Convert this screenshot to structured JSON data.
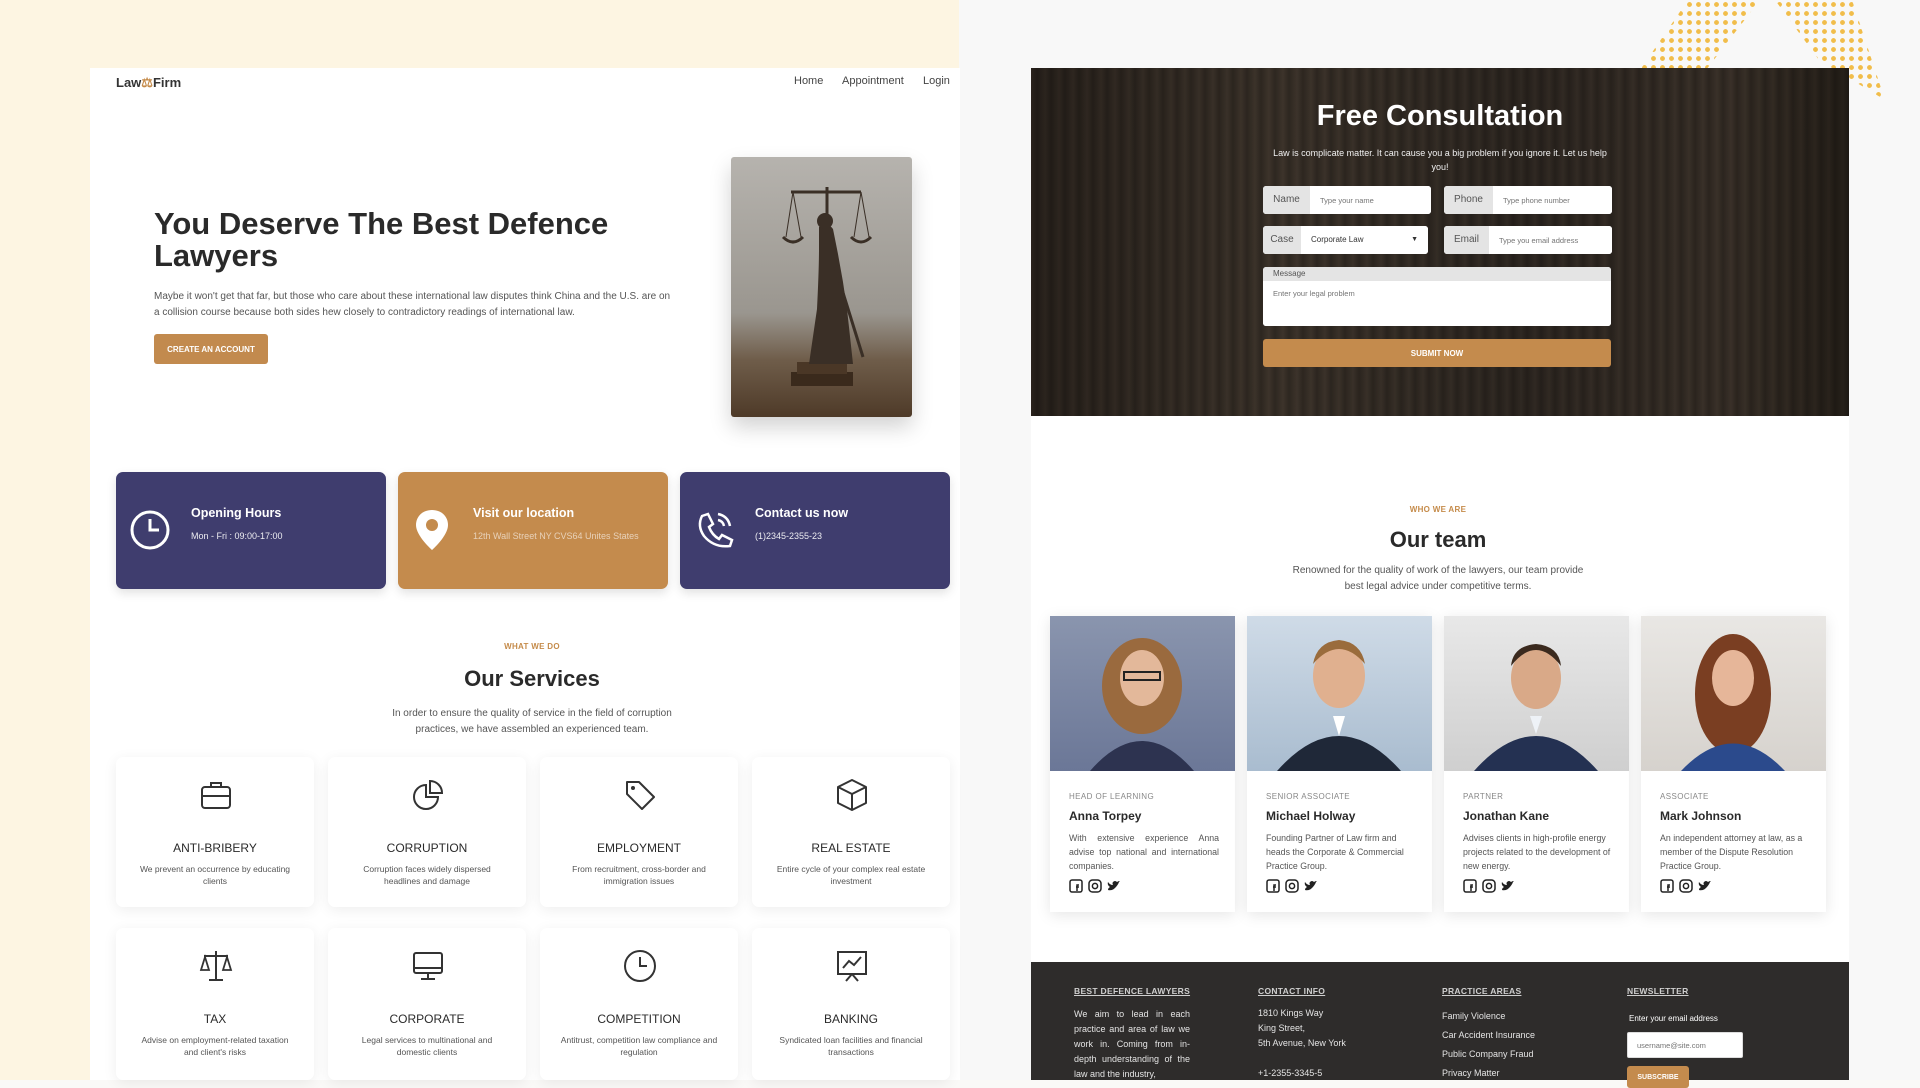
{
  "site": {
    "logo_left": "Law",
    "logo_mark": "⚖",
    "logo_right": "Firm",
    "nav": [
      "Home",
      "Appointment",
      "Login"
    ]
  },
  "hero": {
    "title": "You Deserve The Best Defence Lawyers",
    "text": "Maybe it won't get that far, but those who care about these international law disputes think China and the U.S. are on a collision course because both sides hew closely to contradictory readings of international law.",
    "cta": "CREATE AN ACCOUNT"
  },
  "info_cards": [
    {
      "title": "Opening Hours",
      "sub": "Mon - Fri : 09:00-17:00",
      "icon": "clock-icon"
    },
    {
      "title": "Visit our location",
      "sub": "12th Wall Street NY CVS64 Unites States",
      "icon": "location-pin-icon"
    },
    {
      "title": "Contact us now",
      "sub": "(1)2345-2355-23",
      "icon": "phone-icon"
    }
  ],
  "services": {
    "eyebrow": "WHAT WE DO",
    "title": "Our Services",
    "text": "In order to ensure the quality of service in the field of corruption practices, we have assembled an experienced team.",
    "items": [
      {
        "name": "ANTI-BRIBERY",
        "desc": "We prevent an occurrence by educating clients",
        "icon": "briefcase-icon"
      },
      {
        "name": "CORRUPTION",
        "desc": "Corruption faces widely dispersed headlines and damage",
        "icon": "pie-chart-icon"
      },
      {
        "name": "EMPLOYMENT",
        "desc": "From recruitment, cross-border and immigration issues",
        "icon": "tag-icon"
      },
      {
        "name": "REAL ESTATE",
        "desc": "Entire cycle of your complex real estate investment",
        "icon": "cube-icon"
      },
      {
        "name": "TAX",
        "desc": "Advise on employment-related taxation and client's risks",
        "icon": "scales-icon"
      },
      {
        "name": "CORPORATE",
        "desc": "Legal services to multinational and domestic clients",
        "icon": "monitor-icon"
      },
      {
        "name": "COMPETITION",
        "desc": "Antitrust, competition law compliance and regulation",
        "icon": "clock-icon"
      },
      {
        "name": "BANKING",
        "desc": "Syndicated loan facilities and financial transactions",
        "icon": "chart-board-icon"
      }
    ]
  },
  "consultation": {
    "title": "Free Consultation",
    "sub": "Law is complicate matter. It can cause you a big problem if you ignore it. Let us help you!",
    "name_label": "Name",
    "name_placeholder": "Type your name",
    "phone_label": "Phone",
    "phone_placeholder": "Type phone number",
    "case_label": "Case",
    "case_value": "Corporate Law",
    "email_label": "Email",
    "email_placeholder": "Type you email address",
    "message_label": "Message",
    "message_placeholder": "Enter your legal problem",
    "submit": "SUBMIT NOW"
  },
  "team": {
    "eyebrow": "WHO WE ARE",
    "title": "Our team",
    "text": "Renowned for the quality of work of the lawyers, our team provide best legal advice under competitive terms.",
    "members": [
      {
        "role": "HEAD OF LEARNING",
        "name": "Anna Torpey",
        "bio": "With extensive experience Anna advise top national and international companies."
      },
      {
        "role": "SENIOR ASSOCIATE",
        "name": "Michael Holway",
        "bio": "Founding Partner of Law firm and heads the Corporate & Commercial Practice Group."
      },
      {
        "role": "PARTNER",
        "name": "Jonathan Kane",
        "bio": "Advises clients in high-profile energy projects related to the development of new energy."
      },
      {
        "role": "ASSOCIATE",
        "name": "Mark Johnson",
        "bio": "An independent attorney at law, as a member of the Dispute Resolution Practice Group."
      }
    ]
  },
  "footer": {
    "col1_title": "BEST DEFENCE LAWYERS",
    "col1_text": "We aim to lead in each practice and area of law we work in. Coming from in-depth understanding of the law and the industry,",
    "col2_title": "CONTACT INFO",
    "address": [
      "1810 Kings Way",
      "King Street,",
      "5th Avenue, New York"
    ],
    "phone": "+1-2355-3345-5",
    "col3_title": "PRACTICE AREAS",
    "areas": [
      "Family Violence",
      "Car Accident Insurance",
      "Public Company Fraud",
      "Privacy Matter"
    ],
    "col4_title": "NEWSLETTER",
    "newsletter_label": "Enter your email address",
    "newsletter_placeholder": "username@site.com",
    "subscribe": "SUBSCRIBE"
  },
  "colors": {
    "navy": "#3f3d6e",
    "gold": "#c48b4d",
    "dark": "#2e2c2b"
  }
}
